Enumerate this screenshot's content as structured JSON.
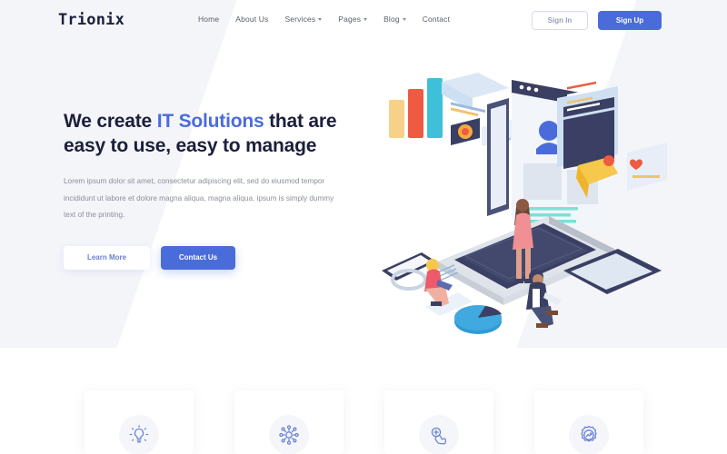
{
  "brand": {
    "name": "Trionix"
  },
  "nav": {
    "items": [
      {
        "label": "Home",
        "dropdown": false
      },
      {
        "label": "About Us",
        "dropdown": false
      },
      {
        "label": "Services",
        "dropdown": true
      },
      {
        "label": "Pages",
        "dropdown": true
      },
      {
        "label": "Blog",
        "dropdown": true
      },
      {
        "label": "Contact",
        "dropdown": false
      }
    ]
  },
  "auth": {
    "sign_in_label": "Sign In",
    "sign_up_label": "Sign Up"
  },
  "hero": {
    "headline_part1": "We create ",
    "headline_accent": "IT Solutions",
    "headline_part2": " that are",
    "headline_line2": "easy to use, easy to manage",
    "paragraph": "Lorem ipsum dolor sit amet, consectetur adipiscing elit, sed do eiusmod tempor incididunt ut labore et dolore magna aliqua, magna aliqua. ipsum is simply dummy text of the printing.",
    "learn_more_label": "Learn More",
    "contact_label": "Contact Us"
  },
  "illustration": {
    "name": "isometric-team-devices-illustration",
    "bar_chart": {
      "bars": [
        "#f7d08a",
        "#ef5a43",
        "#3fc0d9"
      ]
    }
  },
  "features": {
    "cards": [
      {
        "icon": "lightbulb-icon"
      },
      {
        "icon": "network-gear-icon"
      },
      {
        "icon": "hand-touch-icon"
      },
      {
        "icon": "gear-chart-icon"
      }
    ]
  },
  "colors": {
    "accent": "#4a6cdb",
    "heading": "#1b1f3b",
    "muted": "#8a8f9c",
    "band": "#f4f5f9"
  }
}
